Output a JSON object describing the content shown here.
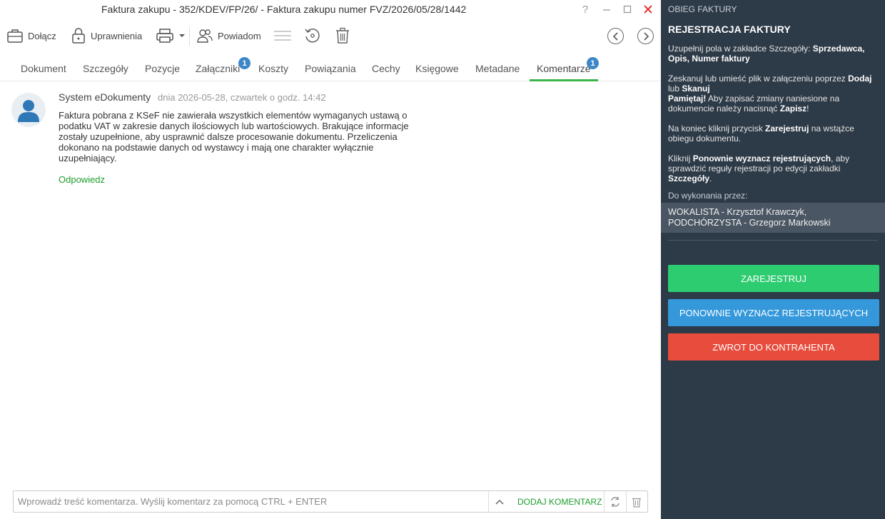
{
  "window": {
    "title": "Faktura zakupu - 352/KDEV/FP/26/ - Faktura zakupu numer FVZ/2026/05/28/1442",
    "help": "?",
    "minimize": "—",
    "maximize": "☐",
    "close": "✕"
  },
  "toolbar": {
    "attach_label": "Dołącz",
    "permissions_label": "Uprawnienia",
    "notify_label": "Powiadom",
    "icons": [
      "briefcase-icon",
      "lock-icon",
      "printer-icon",
      "people-icon",
      "menu-icon",
      "history-icon",
      "trash-icon",
      "chevron-left-icon",
      "chevron-right-icon"
    ]
  },
  "tabs": [
    {
      "label": "Dokument"
    },
    {
      "label": "Szczegóły"
    },
    {
      "label": "Pozycje"
    },
    {
      "label": "Załączniki",
      "badge": "1"
    },
    {
      "label": "Koszty"
    },
    {
      "label": "Powiązania"
    },
    {
      "label": "Cechy"
    },
    {
      "label": "Księgowe"
    },
    {
      "label": "Metadane"
    },
    {
      "label": "Komentarze",
      "badge": "1",
      "active": true
    }
  ],
  "comment": {
    "author": "System eDokumenty",
    "date": "dnia 2026-05-28, czwartek o godz. 14:42",
    "text": "Faktura pobrana z KSeF nie zawierała wszystkich elementów wymaganych ustawą o podatku VAT w zakresie danych ilościowych lub wartościowych. Brakujące informacje zostały uzupełnione, aby usprawnić dalsze procesowanie dokumentu. Przeliczenia dokonano na podstawie danych od wystawcy i mają one charakter wyłącznie uzupełniający.",
    "reply": "Odpowiedz"
  },
  "composer": {
    "placeholder": "Wprowadź treść komentarza. Wyślij komentarz za pomocą CTRL + ENTER",
    "add_label": "DODAJ KOMENTARZ"
  },
  "sidebar": {
    "section": "OBIEG FAKTURY",
    "heading": "REJESTRACJA FAKTURY",
    "p1": {
      "text": "Uzupełnij pola w zakładce Szczegóły: ",
      "bold": "Sprzedawca, Opis, Numer faktury"
    },
    "p2": {
      "t1": "Zeskanuj lub umieść plik w załączeniu poprzez ",
      "b1": "Dodaj",
      "t2": " lub ",
      "b2": "Skanuj",
      "b3": "Pamiętaj!",
      "t3": " Aby zapisać zmiany naniesione na dokumencie należy nacisnąć ",
      "b4": "Zapisz",
      "t4": "!"
    },
    "p3": {
      "t1": "Na koniec kliknij przycisk ",
      "b1": "Zarejestruj",
      "t2": " na wstążce obiegu dokumentu."
    },
    "p4": {
      "t1": "Kliknij ",
      "b1": "Ponownie wyznacz rejestrujących",
      "t2": ", aby sprawdzić reguły rejestracji po edycji zakładki ",
      "b2": "Szczegóły",
      "t3": "."
    },
    "todo_label": "Do wykonania przez:",
    "assignees_line1": "WOKALISTA - Krzysztof Krawczyk,",
    "assignees_line2": "PODCHÓRZYSTA - Grzegorz Markowski",
    "btn_register": "ZAREJESTRUJ",
    "btn_reassign": "PONOWNIE WYZNACZ REJESTRUJĄCYCH",
    "btn_return": "ZWROT DO KONTRAHENTA"
  },
  "colors": {
    "sidebar_bg": "#2d3a47",
    "register": "#2ecc71",
    "reassign": "#3498db",
    "return": "#e74c3c",
    "accent_green": "#3bb54a",
    "badge_blue": "#3d87c8"
  }
}
